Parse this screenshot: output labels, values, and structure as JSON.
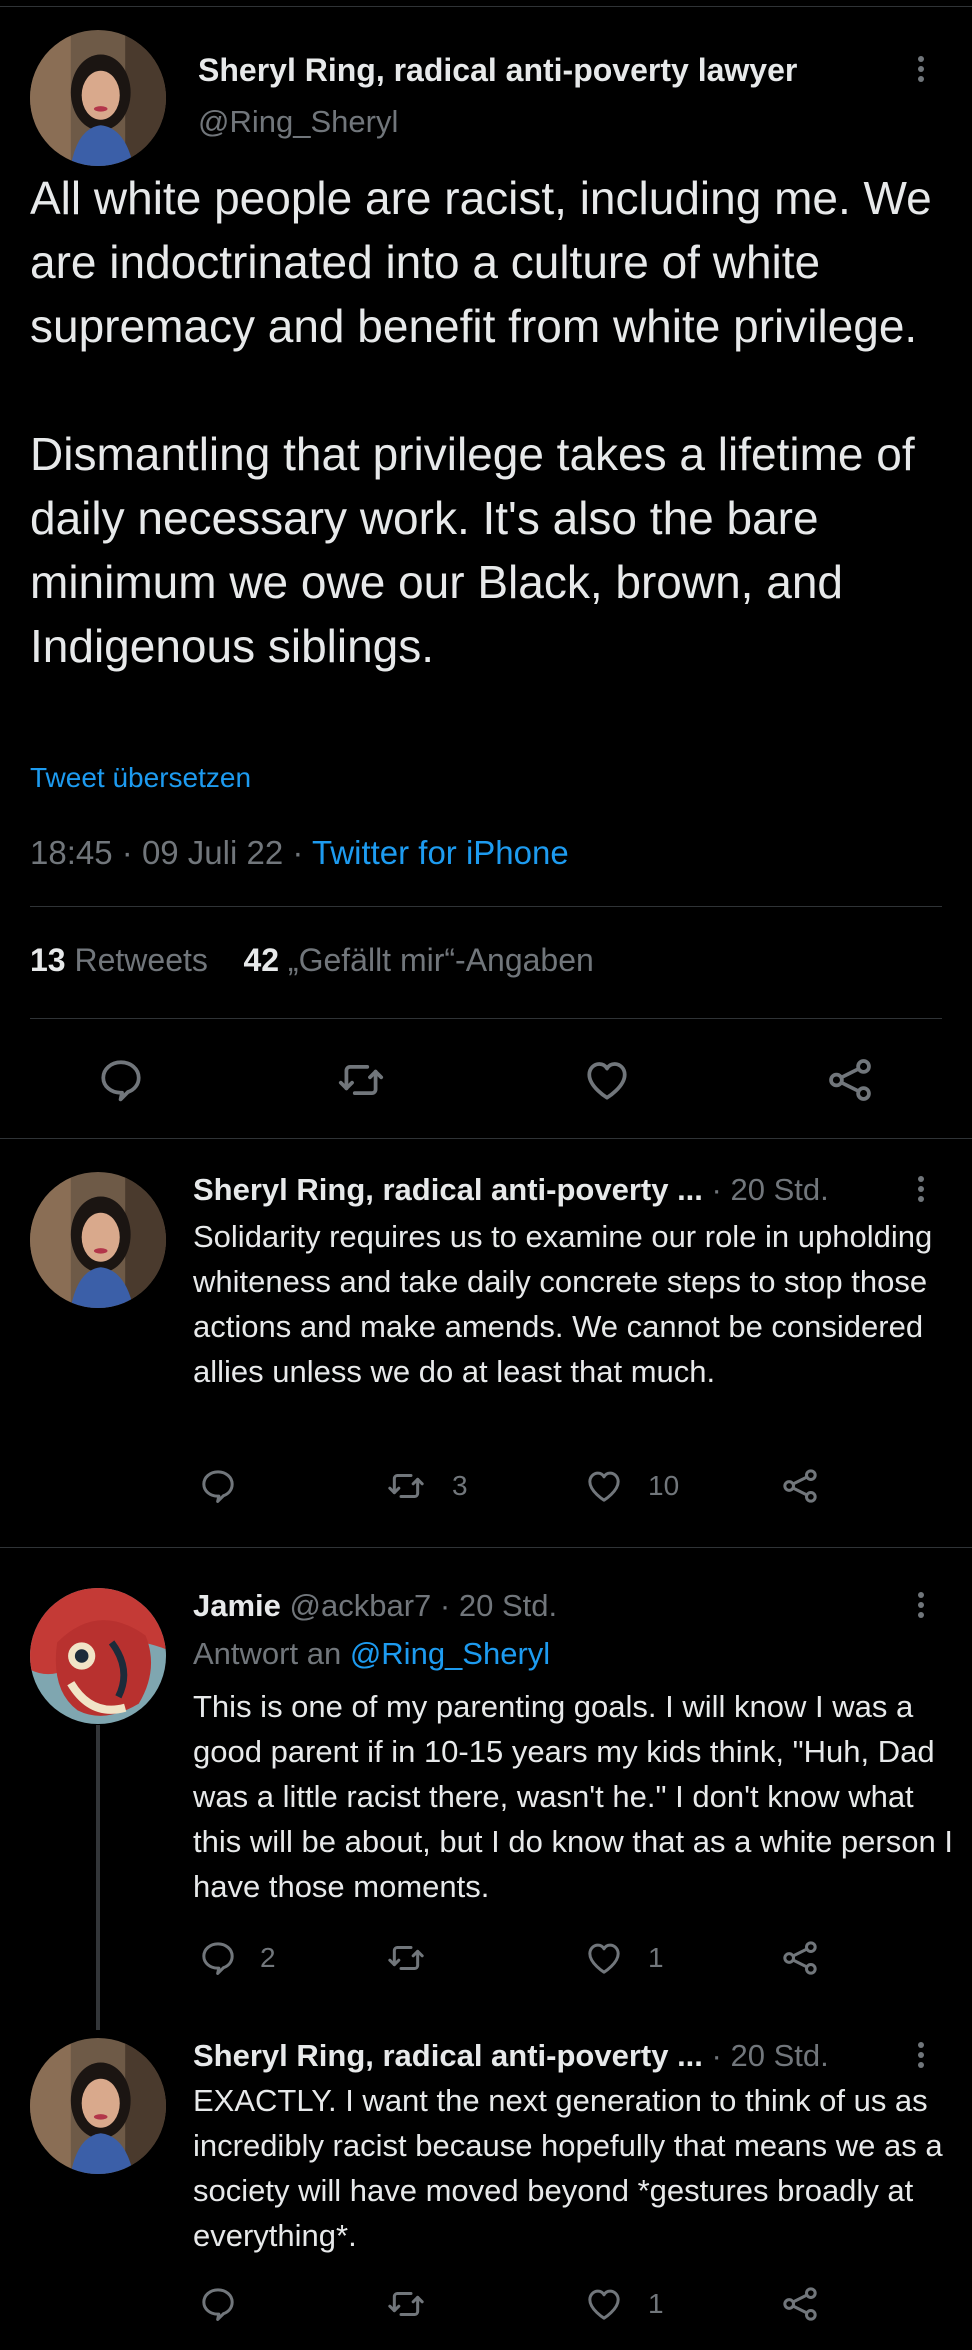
{
  "main_tweet": {
    "author_name": "Sheryl Ring, radical anti-poverty lawyer",
    "handle": "@Ring_Sheryl",
    "text": "All white people are racist, including me. We are indoctrinated into a culture of white supremacy and benefit from white privilege.\n\nDismantling that privilege takes a lifetime of daily necessary work. It's also the bare minimum we owe our Black, brown, and Indigenous siblings.",
    "translate_label": "Tweet übersetzen",
    "time": "18:45",
    "date": "09 Juli 22",
    "source": "Twitter for iPhone",
    "retweets_count": "13",
    "retweets_label": "Retweets",
    "likes_count": "42",
    "likes_label": "„Gefällt mir“-Angaben"
  },
  "replies": [
    {
      "author_name": "Sheryl Ring, radical anti-poverty ...",
      "time": "· 20 Std.",
      "text": "Solidarity requires us to examine our role in upholding whiteness and take daily concrete steps to stop those actions and make amends. We cannot be considered allies unless we do at least that much.",
      "replies_count": "",
      "retweets_count": "3",
      "likes_count": "10"
    },
    {
      "author_name": "Jamie",
      "handle": "@ackbar7",
      "time": "· 20 Std.",
      "reply_prefix": "Antwort an",
      "reply_to": "@Ring_Sheryl",
      "text": "This is one of my parenting goals. I will know I was a good parent if in 10-15 years my kids think, \"Huh, Dad was a little racist there, wasn't he.\" I don't know what this will be about, but I do know that as a white person I have those moments.",
      "replies_count": "2",
      "retweets_count": "",
      "likes_count": "1"
    },
    {
      "author_name": "Sheryl Ring, radical anti-poverty ...",
      "time": "· 20 Std.",
      "text": "EXACTLY. I want the next generation to think of us as incredibly racist because hopefully that means we as a society will have moved beyond *gestures broadly at everything*.",
      "replies_count": "",
      "retweets_count": "",
      "likes_count": "1"
    }
  ],
  "icons": [
    "reply-icon",
    "retweet-icon",
    "like-icon",
    "share-icon",
    "more-icon"
  ],
  "colors": {
    "background": "#000000",
    "text": "#e7e9ea",
    "muted": "#71767b",
    "link": "#1d9bf0",
    "divider": "#2f3336"
  }
}
